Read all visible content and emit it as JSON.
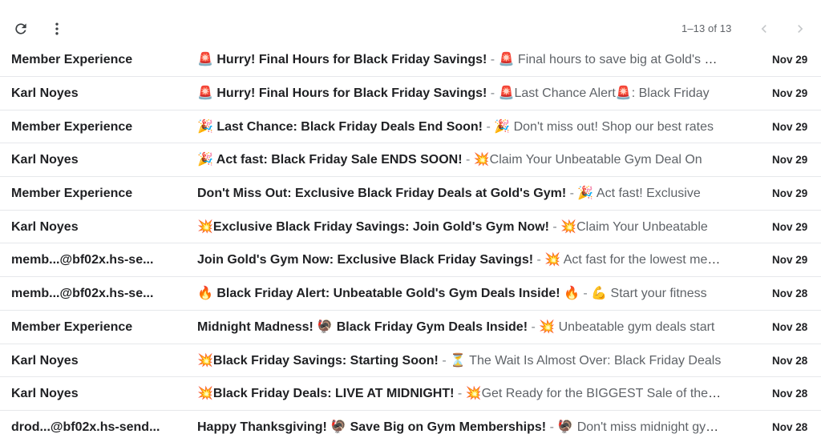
{
  "toolbar": {
    "refresh_icon": "refresh-icon",
    "more_icon": "more-vert-icon",
    "pager": "1–13 of 13",
    "prev_icon": "chevron-left-icon",
    "next_icon": "chevron-right-icon"
  },
  "emails": [
    {
      "sender": "Member Experience",
      "subject": "🚨 Hurry! Final Hours for Black Friday Savings!",
      "separator": " - ",
      "snippet": "🚨 Final hours to save big at Gold's Gym",
      "date": "Nov 29"
    },
    {
      "sender": "Karl Noyes",
      "subject": "🚨 Hurry! Final Hours for Black Friday Savings!",
      "separator": " - ",
      "snippet": "🚨Last Chance Alert🚨: Black Friday",
      "date": "Nov 29"
    },
    {
      "sender": "Member Experience",
      "subject": "🎉 Last Chance: Black Friday Deals End Soon!",
      "separator": " - ",
      "snippet": "🎉 Don't miss out! Shop our best rates",
      "date": "Nov 29"
    },
    {
      "sender": "Karl Noyes",
      "subject": "🎉 Act fast: Black Friday Sale ENDS SOON!",
      "separator": " - ",
      "snippet": "💥Claim Your Unbeatable Gym Deal On",
      "date": "Nov 29"
    },
    {
      "sender": "Member Experience",
      "subject": "Don't Miss Out: Exclusive Black Friday Deals at Gold's Gym!",
      "separator": " - ",
      "snippet": "🎉 Act fast! Exclusive",
      "date": "Nov 29"
    },
    {
      "sender": "Karl Noyes",
      "subject": "💥Exclusive Black Friday Savings: Join Gold's Gym Now!",
      "separator": " - ",
      "snippet": "💥Claim Your Unbeatable",
      "date": "Nov 29"
    },
    {
      "sender": "memb...@bf02x.hs-se...",
      "subject": "Join Gold's Gym Now: Exclusive Black Friday Savings!",
      "separator": " - ",
      "snippet": "💥 Act fast for the lowest membership",
      "date": "Nov 29"
    },
    {
      "sender": "memb...@bf02x.hs-se...",
      "subject": "🔥 Black Friday Alert: Unbeatable Gold's Gym Deals Inside! 🔥",
      "separator": " - ",
      "snippet": "💪 Start your fitness",
      "date": "Nov 28"
    },
    {
      "sender": "Member Experience",
      "subject": "Midnight Madness! 🦃 Black Friday Gym Deals Inside!",
      "separator": " - ",
      "snippet": "💥 Unbeatable gym deals start",
      "date": "Nov 28"
    },
    {
      "sender": "Karl Noyes",
      "subject": "💥Black Friday Savings: Starting Soon!",
      "separator": " - ",
      "snippet": "⏳ The Wait Is Almost Over: Black Friday Deals",
      "date": "Nov 28"
    },
    {
      "sender": "Karl Noyes",
      "subject": "💥Black Friday Deals: LIVE AT MIDNIGHT!",
      "separator": " - ",
      "snippet": "💥Get Ready for the BIGGEST Sale of the Year",
      "date": "Nov 28"
    },
    {
      "sender": "drod...@bf02x.hs-send...",
      "subject": "Happy Thanksgiving! 🦃 Save Big on Gym Memberships!",
      "separator": " - ",
      "snippet": "🦃 Don't miss midnight gym deals",
      "date": "Nov 28"
    }
  ]
}
